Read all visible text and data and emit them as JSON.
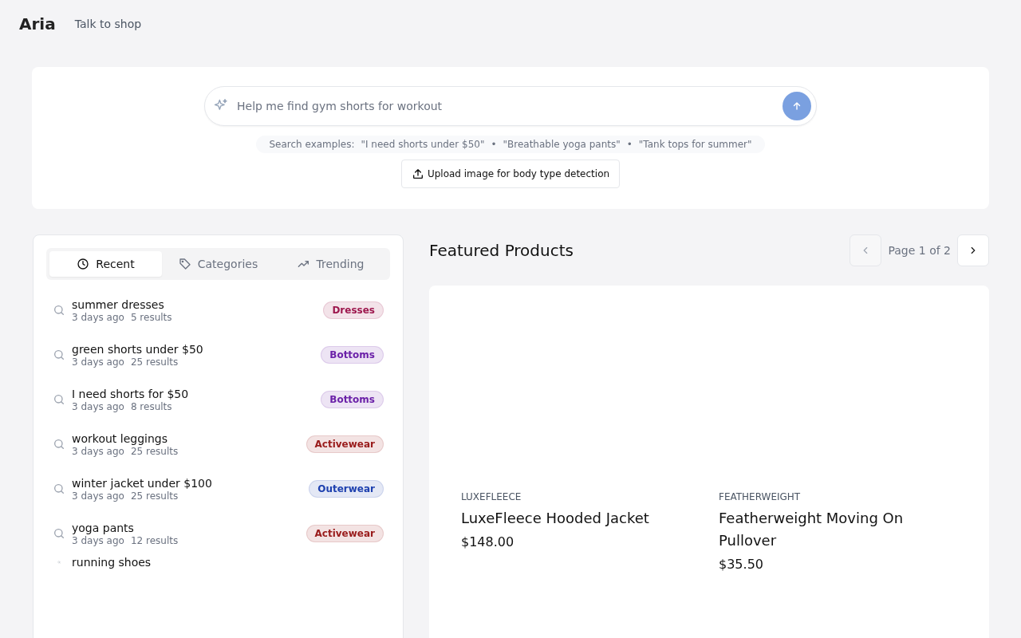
{
  "header": {
    "logo": "Aria",
    "nav_link": "Talk to shop"
  },
  "search": {
    "placeholder": "Help me find gym shorts for workout",
    "examples_label": "Search examples:",
    "examples": [
      "\"I need shorts under $50\"",
      "\"Breathable yoga pants\"",
      "\"Tank tops for summer\""
    ],
    "separator": "•",
    "upload_button": "Upload image for body type detection"
  },
  "tabs": [
    {
      "label": "Recent",
      "selected": true
    },
    {
      "label": "Categories",
      "selected": false
    },
    {
      "label": "Trending",
      "selected": false
    }
  ],
  "recent": [
    {
      "kind": "full",
      "query": "summer dresses",
      "time": "3 days ago",
      "results": "5 results",
      "tag": "Dresses",
      "color": "#9d174d"
    },
    {
      "kind": "full",
      "query": "green shorts under $50",
      "time": "3 days ago",
      "results": "25 results",
      "tag": "Bottoms",
      "color": "#6b21a8"
    },
    {
      "kind": "full",
      "query": "I need shorts for $50",
      "time": "3 days ago",
      "results": "8 results",
      "tag": "Bottoms",
      "color": "#6b21a8"
    },
    {
      "kind": "full",
      "query": "workout leggings",
      "time": "3 days ago",
      "results": "25 results",
      "tag": "Activewear",
      "color": "#991b1b"
    },
    {
      "kind": "full",
      "query": "winter jacket under $100",
      "time": "3 days ago",
      "results": "25 results",
      "tag": "Outerwear",
      "color": "#1e40af"
    },
    {
      "kind": "full",
      "query": "yoga pants",
      "time": "3 days ago",
      "results": "12 results",
      "tag": "Activewear",
      "color": "#991b1b"
    },
    {
      "kind": "cut",
      "query": "running shoes"
    }
  ],
  "featured": {
    "title": "Featured Products",
    "page_label": "Page 1 of 2",
    "prev_disabled": true,
    "next_disabled": false
  },
  "products": [
    {
      "brand": "LUXEFLEECE",
      "name": "LuxeFleece Hooded Jacket",
      "price": "$148.00"
    },
    {
      "brand": "FEATHERWEIGHT",
      "name": "Featherweight Moving On Pullover",
      "price": "$35.50"
    }
  ]
}
